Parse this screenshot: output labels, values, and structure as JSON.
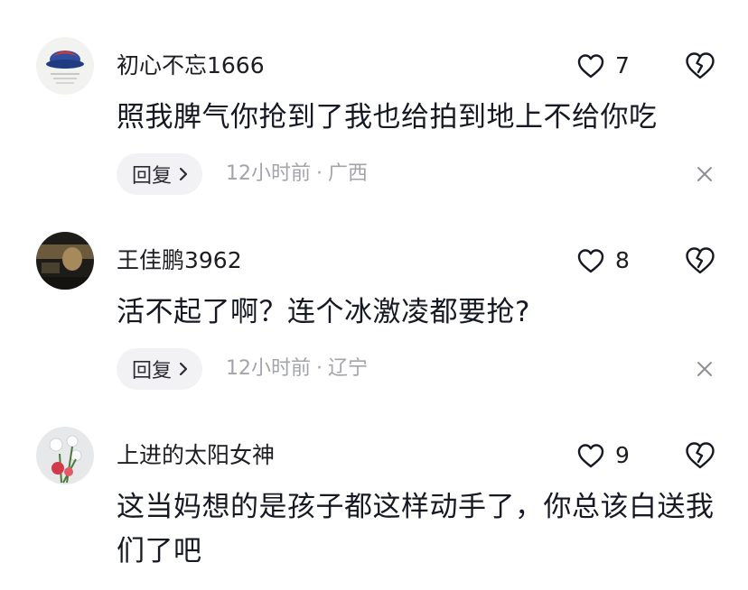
{
  "comments": [
    {
      "username": "初心不忘1666",
      "likes": "7",
      "text": "照我脾气你抢到了我也给拍到地上不给你吃",
      "reply_label": "回复",
      "time": "12小时前",
      "separator": "·",
      "location": "广西",
      "avatar_icon": "hat-on-white-avatar"
    },
    {
      "username": "王佳鹏3962",
      "likes": "8",
      "text": "活不起了啊？连个冰激凌都要抢?",
      "reply_label": "回复",
      "time": "12小时前",
      "separator": "·",
      "location": "辽宁",
      "avatar_icon": "dark-photo-avatar"
    },
    {
      "username": "上进的太阳女神",
      "likes": "9",
      "text": "这当妈想的是孩子都这样动手了，你总该白送我们了吧",
      "avatar_icon": "flower-avatar"
    }
  ],
  "icons": {
    "like": "heart-outline-icon",
    "dislike": "broken-heart-icon",
    "chevron": "chevron-right-icon",
    "close": "close-x-icon"
  },
  "colors": {
    "text": "#161823",
    "meta": "#a3a4aa",
    "reply_bg": "#f2f2f4"
  }
}
